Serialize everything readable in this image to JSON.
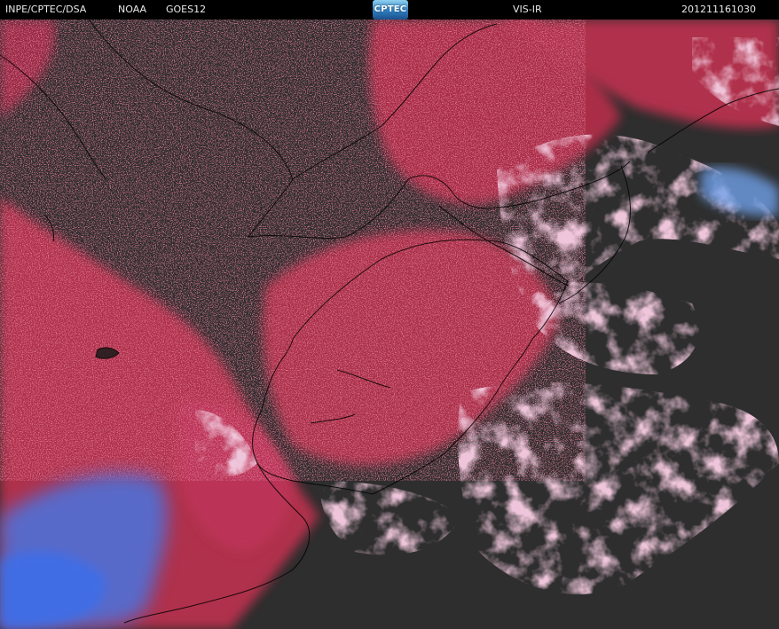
{
  "header": {
    "agency": "INPE/CPTEC/DSA",
    "provider": "NOAA",
    "satellite": "GOES12",
    "product": "VIS-IR",
    "datetime": "201211161030"
  },
  "logo": {
    "text": "CPTEC"
  },
  "colors": {
    "background": "#2e2e2e",
    "low_cloud_land": "#b8304e",
    "high_cloud": "#d88ab0",
    "cold_cloud": "#4a74e0",
    "borders": "#000000"
  }
}
